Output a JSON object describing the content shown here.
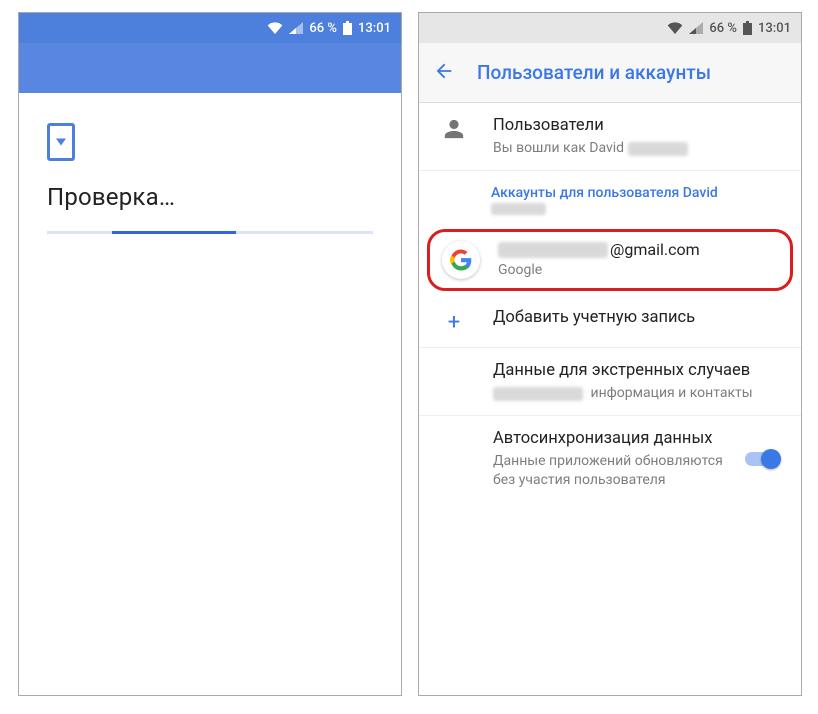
{
  "status": {
    "battery_pct": "66 %",
    "time": "13:01"
  },
  "left": {
    "title": "Проверка…"
  },
  "right": {
    "header": "Пользователи и аккаунты",
    "users": {
      "title": "Пользователи",
      "subtitle_prefix": "Вы вошли как David"
    },
    "section_label": "Аккаунты для пользователя David",
    "account": {
      "email_suffix": "@gmail.com",
      "provider": "Google"
    },
    "add_account": "Добавить учетную запись",
    "emergency": {
      "title": "Данные для экстренных случаев",
      "subtitle_suffix": "информация и контакты"
    },
    "autosync": {
      "title": "Автосинхронизация данных",
      "subtitle": "Данные приложений обновляются без участия пользователя"
    }
  }
}
